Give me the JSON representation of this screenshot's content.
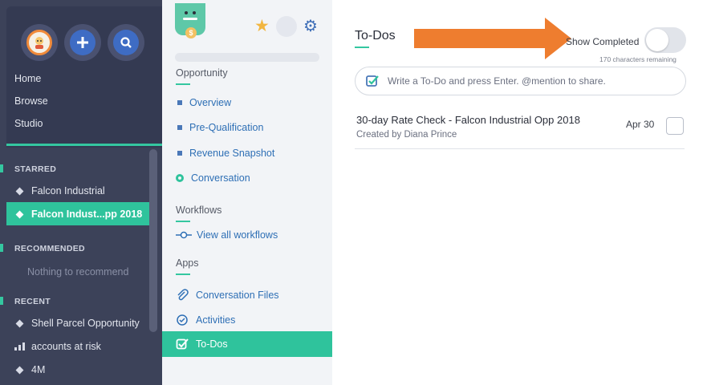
{
  "colors": {
    "accent": "#34c7a0",
    "sidebar": "#3c4259",
    "link": "#2e6fb5",
    "arrow": "#ee7d2f"
  },
  "sidebar": {
    "icons": [
      "avatar",
      "plus-icon",
      "search-icon"
    ],
    "nav": [
      {
        "label": "Home"
      },
      {
        "label": "Browse"
      },
      {
        "label": "Studio"
      }
    ],
    "starred": {
      "heading": "STARRED",
      "items": [
        {
          "label": "Falcon Industrial",
          "icon": "diamond-icon"
        },
        {
          "label": "Falcon Indust...pp 2018",
          "icon": "diamond-icon",
          "active": true
        }
      ]
    },
    "recommended": {
      "heading": "RECOMMENDED",
      "empty_text": "Nothing to recommend"
    },
    "recent": {
      "heading": "RECENT",
      "items": [
        {
          "label": "Shell Parcel Opportunity",
          "icon": "diamond-icon"
        },
        {
          "label": "accounts at risk",
          "icon": "bar-chart-icon"
        },
        {
          "label": "4M",
          "icon": "diamond-icon"
        }
      ]
    }
  },
  "panel": {
    "icons": [
      "app-logo-icon",
      "star-icon",
      "gear-icon"
    ],
    "opportunity": {
      "title": "Opportunity",
      "links": [
        {
          "label": "Overview"
        },
        {
          "label": "Pre-Qualification"
        },
        {
          "label": "Revenue Snapshot"
        },
        {
          "label": "Conversation"
        }
      ]
    },
    "workflows": {
      "title": "Workflows",
      "link": "View all workflows"
    },
    "apps": {
      "title": "Apps",
      "links": [
        {
          "label": "Conversation Files",
          "icon": "paperclip-icon"
        },
        {
          "label": "Activities",
          "icon": "activity-icon"
        },
        {
          "label": "To-Dos",
          "icon": "checkbox-icon",
          "active": true
        }
      ]
    }
  },
  "main": {
    "title": "To-Dos",
    "show_completed_label": "Show Completed",
    "show_completed_on": false,
    "chars_remaining": "170 characters remaining",
    "input_placeholder": "Write a To-Do and press Enter. @mention to share.",
    "tasks": [
      {
        "title": "30-day Rate Check - Falcon Industrial Opp 2018",
        "created_by": "Created by Diana Prince",
        "due": "Apr 30",
        "done": false
      }
    ]
  }
}
